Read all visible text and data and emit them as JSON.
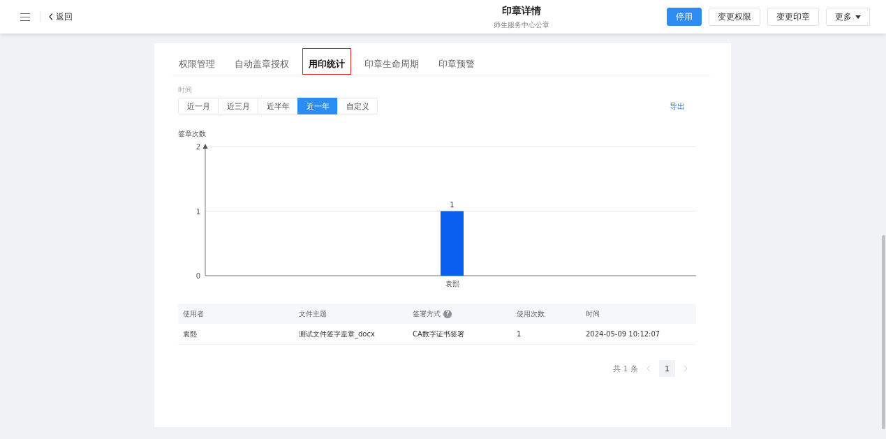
{
  "header": {
    "back": "返回",
    "title": "印章详情",
    "subtitle": "师生服务中心公章",
    "buttons": [
      {
        "label": "停用",
        "kind": "primary"
      },
      {
        "label": "变更权限",
        "kind": "default"
      },
      {
        "label": "变更印章",
        "kind": "default"
      },
      {
        "label": "更多",
        "kind": "dropdown"
      }
    ]
  },
  "tabs": [
    {
      "label": "权限管理",
      "selected": false
    },
    {
      "label": "自动盖章授权",
      "selected": false
    },
    {
      "label": "用印统计",
      "selected": true
    },
    {
      "label": "印章生命周期",
      "selected": false
    },
    {
      "label": "印章预警",
      "selected": false
    }
  ],
  "filter": {
    "label": "时间",
    "options": [
      {
        "label": "近一月",
        "selected": false
      },
      {
        "label": "近三月",
        "selected": false
      },
      {
        "label": "近半年",
        "selected": false
      },
      {
        "label": "近一年",
        "selected": true
      },
      {
        "label": "自定义",
        "selected": false
      }
    ],
    "export": "导出"
  },
  "chart": {
    "chart_data": {
      "type": "bar",
      "ylabel": "签章次数",
      "categories": [
        "袁熙"
      ],
      "values": [
        1
      ],
      "ylim": [
        0,
        2
      ],
      "yticks": [
        0,
        1,
        2
      ],
      "data_labels": true
    }
  },
  "table": {
    "columns": [
      {
        "label": "使用者"
      },
      {
        "label": "文件主题"
      },
      {
        "label": "签署方式",
        "help": "?"
      },
      {
        "label": "使用次数"
      },
      {
        "label": "时间"
      }
    ],
    "rows": [
      [
        "袁熙",
        "测试文件签字盖章_docx",
        "CA数字证书签署",
        "1",
        "2024-05-09 10:12:07"
      ]
    ]
  },
  "pagination": {
    "total": "共 1 条",
    "pages": [
      {
        "label": "1",
        "selected": true
      }
    ]
  }
}
